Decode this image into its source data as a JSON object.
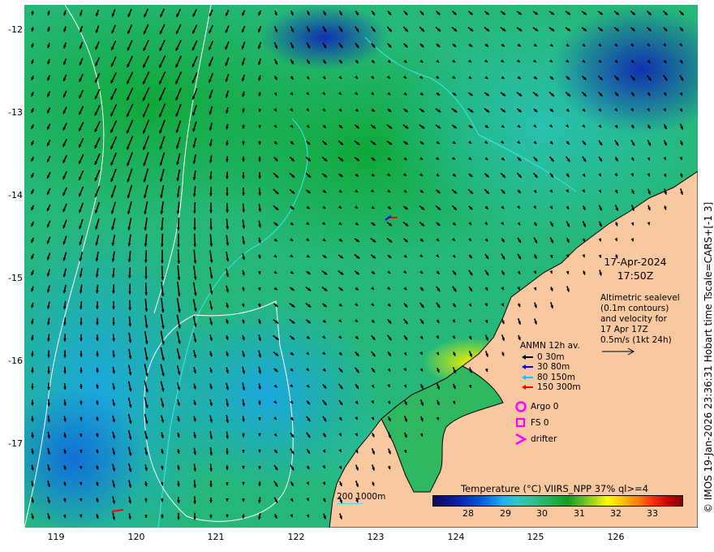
{
  "map": {
    "lon_ticks": [
      "119",
      "120",
      "121",
      "122",
      "123",
      "124",
      "125",
      "126"
    ],
    "lat_ticks": [
      "-12",
      "-13",
      "-14",
      "-15",
      "-16",
      "-17"
    ],
    "colors": {
      "land": "#f8c8a0",
      "coast": "#000000",
      "contour": "#40e8e8",
      "sealevel_contour": "#ffffff",
      "arrow": "#000000"
    }
  },
  "date": {
    "line1": "17-Apr-2024",
    "line2": "17:50Z"
  },
  "altimetry": {
    "lines": [
      "Altimetric sealevel",
      "(0.1m contours)",
      "and velocity for",
      "17 Apr 17Z",
      "0.5m/s (1kt 24h)"
    ]
  },
  "anmn_legend": {
    "title": "ANMN 12h av.",
    "items": [
      {
        "label": "0 30m",
        "color": "#000000"
      },
      {
        "label": "30 80m",
        "color": "#0000ff"
      },
      {
        "label": "80 150m",
        "color": "#00c8ff"
      },
      {
        "label": "150 300m",
        "color": "#ff0000"
      }
    ]
  },
  "markers": [
    {
      "label": "Argo 0",
      "icon": "magenta-circle",
      "color": "#ff00ff"
    },
    {
      "label": "FS 0",
      "icon": "magenta-square",
      "color": "#ff00ff"
    },
    {
      "label": "drifter",
      "icon": "magenta-chevron",
      "color": "#ff00ff"
    }
  ],
  "colorbar": {
    "title": "Temperature (°C) VIIRS_NPP 37% ql>=4",
    "ticks": [
      "28",
      "29",
      "30",
      "31",
      "32",
      "33"
    ]
  },
  "depth_contour_label": "200  1000m",
  "credit": "© IMOS 19-Jan-2026 23:36:31 Hobart time Tscale=CARS+[-1 3]"
}
